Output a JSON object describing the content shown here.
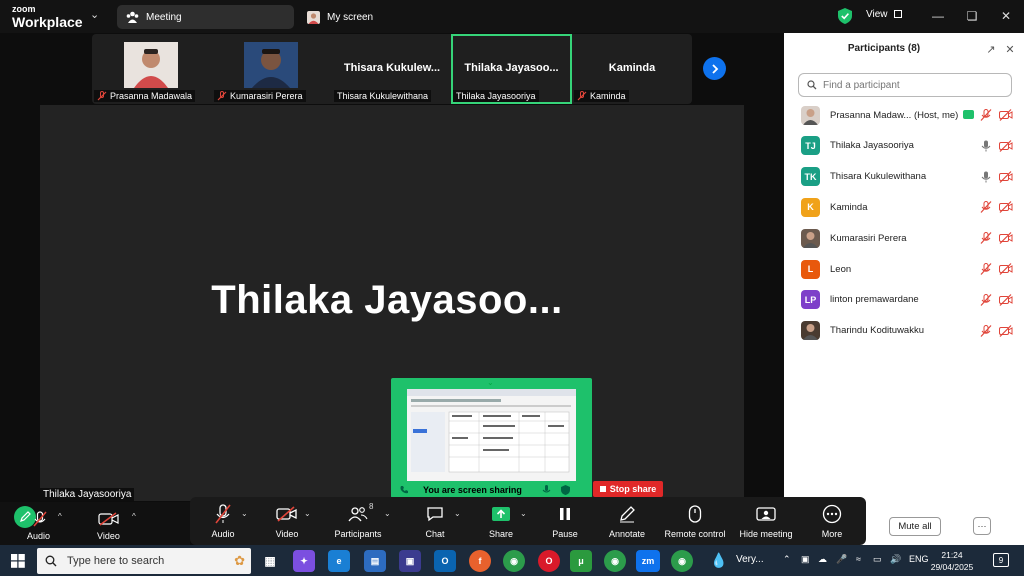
{
  "titlebar": {
    "brand_top": "zoom",
    "brand_bottom": "Workplace",
    "tab_meeting": "Meeting",
    "tab_myscreen": "My screen",
    "view_label": "View"
  },
  "strip": {
    "tiles": [
      {
        "caption": "Prasanna Madawala",
        "big": ""
      },
      {
        "caption": "Kumarasiri Perera",
        "big": ""
      },
      {
        "caption": "Thisara Kukulewithana",
        "big": "Thisara  Kukulew..."
      },
      {
        "caption": "Thilaka Jayasooriya",
        "big": "Thilaka  Jayasoo..."
      },
      {
        "caption": "Kaminda",
        "big": "Kaminda"
      }
    ]
  },
  "main": {
    "speaker_big": "Thilaka  Jayasoo...",
    "speaker_label": "Thilaka Jayasooriya"
  },
  "share": {
    "banner": "You are screen sharing",
    "stop": "Stop share"
  },
  "panel": {
    "title": "Participants (8)",
    "search_placeholder": "Find a participant",
    "participants": [
      {
        "name": "Prasanna Madaw... (Host, me)",
        "initials": "",
        "color": "#d9cfc8",
        "mic": "muted"
      },
      {
        "name": "Thilaka Jayasooriya",
        "initials": "TJ",
        "color": "#1a9f85",
        "mic": "on"
      },
      {
        "name": "Thisara Kukulewithana",
        "initials": "TK",
        "color": "#1a9f85",
        "mic": "on"
      },
      {
        "name": "Kaminda",
        "initials": "K",
        "color": "#f0a21a",
        "mic": "muted"
      },
      {
        "name": "Kumarasiri Perera",
        "initials": "",
        "color": "#6b5a4e",
        "mic": "muted"
      },
      {
        "name": "Leon",
        "initials": "L",
        "color": "#e8590c",
        "mic": "muted"
      },
      {
        "name": "linton premawardane",
        "initials": "LP",
        "color": "#7e3fc9",
        "mic": "muted"
      },
      {
        "name": "Tharindu Kodituwakku",
        "initials": "",
        "color": "#4a3b30",
        "mic": "muted"
      }
    ],
    "mute_all": "Mute all",
    "more": "···"
  },
  "controls": {
    "left_audio": "Audio",
    "left_video": "Video",
    "audio": "Audio",
    "video": "Video",
    "participants": "Participants",
    "participants_count": "8",
    "chat": "Chat",
    "share": "Share",
    "pause": "Pause",
    "annotate": "Annotate",
    "remote_control": "Remote control",
    "hide_meeting": "Hide meeting",
    "more": "More"
  },
  "taskbar": {
    "search_placeholder": "Type here to search",
    "weather": "Very...",
    "lang": "ENG",
    "time": "21:24",
    "date": "29/04/2025",
    "notif_count": "9"
  },
  "colors": {
    "accent_green": "#1ec16b",
    "zoom_blue": "#0e72ed",
    "stop_red": "#e02828",
    "mute_red": "#e0453a"
  }
}
